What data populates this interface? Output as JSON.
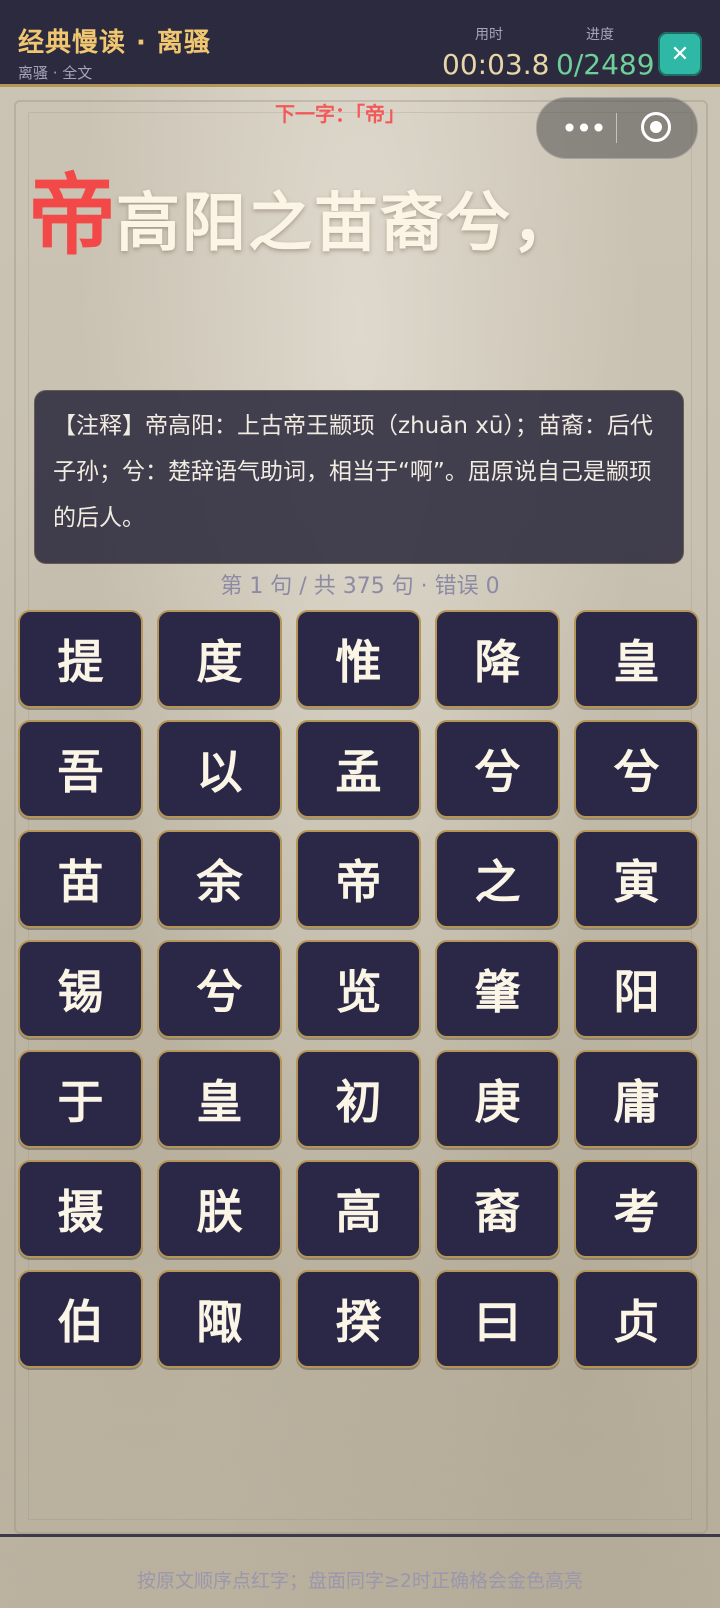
{
  "header": {
    "title": "经典慢读 · 离骚",
    "subtitle": "离骚 · 全文",
    "time_label": "用时",
    "time_value": "00:03.8",
    "progress_label": "进度",
    "progress_value": "0/2489",
    "close_label": "✕"
  },
  "capsule": {
    "more_label": "•••"
  },
  "next_hint": "下一字：「帝」",
  "verse": {
    "highlight_char": "帝",
    "rest": "高阳之苗裔兮，"
  },
  "note": "【注释】帝高阳：上古帝王颛顼（zhuān xū）；苗裔：后代子孙；兮：楚辞语气助词，相当于“啊”。屈原说自己是颛顼的后人。",
  "status": "第 1 句 / 共 375 句 · 错误 0",
  "tiles": [
    "提",
    "度",
    "惟",
    "降",
    "皇",
    "吾",
    "以",
    "孟",
    "兮",
    "兮",
    "苗",
    "余",
    "帝",
    "之",
    "寅",
    "锡",
    "兮",
    "览",
    "肇",
    "阳",
    "于",
    "皇",
    "初",
    "庚",
    "庸",
    "摄",
    "朕",
    "高",
    "裔",
    "考",
    "伯",
    "陬",
    "揆",
    "曰",
    "贞"
  ],
  "footer_hint": "按原文顺序点红字；盘面同字≥2时正确格会金色高亮",
  "colors": {
    "accent_gold": "#f0c670",
    "highlight_red": "#f24848",
    "progress_green": "#6fcf9a",
    "tile_bg": "#2b2747",
    "tile_border": "#b59656",
    "close_btn": "#30b8a6"
  }
}
